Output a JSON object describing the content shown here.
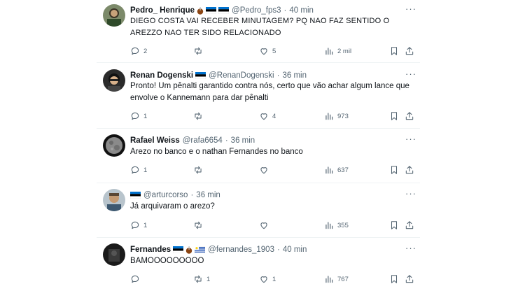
{
  "tweets": [
    {
      "name": "Pedro_ Henrique",
      "handle": "@Pedro_fps3",
      "time": "40 min",
      "text": "DIEGO COSTA VAI RECEBER MINUTAGEM? PQ NAO FAZ SENTIDO O AREZZO NAO TER SIDO RELACIONADO",
      "replies": "2",
      "reposts": "",
      "likes": "5",
      "views": "2 mil"
    },
    {
      "name": "Renan Dogenski",
      "handle": "@RenanDogenski",
      "time": "36 min",
      "text": "Pronto! Um pênalti garantido contra nós, certo que vão achar algum lance que envolve o Kannemann para dar pênalti",
      "replies": "1",
      "reposts": "",
      "likes": "4",
      "views": "973"
    },
    {
      "name": "Rafael Weiss",
      "handle": "@rafa6654",
      "time": "36 min",
      "text": "Arezo no banco e o nathan Fernandes no banco",
      "replies": "1",
      "reposts": "",
      "likes": "",
      "views": "637"
    },
    {
      "name": "",
      "handle": "@arturcorso",
      "time": "36 min",
      "text": "Já arquivaram o arezo?",
      "replies": "1",
      "reposts": "",
      "likes": "",
      "views": "355"
    },
    {
      "name": "Fernandes",
      "handle": "@fernandes_1903",
      "time": "40 min",
      "text": "BAMOOOOOOOOO",
      "replies": "",
      "reposts": "1",
      "likes": "1",
      "views": "767"
    }
  ],
  "separator": "·",
  "more_label": "···",
  "colors": {
    "text": "#0f1419",
    "muted": "#536471",
    "divider": "#eff3f4",
    "flag_estonia": [
      "#0072ce",
      "#000000",
      "#ffffff"
    ],
    "mate_cup": "#8b4513"
  },
  "icons": [
    "reply-icon",
    "repost-icon",
    "like-icon",
    "views-icon",
    "bookmark-icon",
    "share-icon",
    "more-icon",
    "estonia-flag-icon",
    "mate-cup-icon",
    "uruguay-flag-icon"
  ]
}
